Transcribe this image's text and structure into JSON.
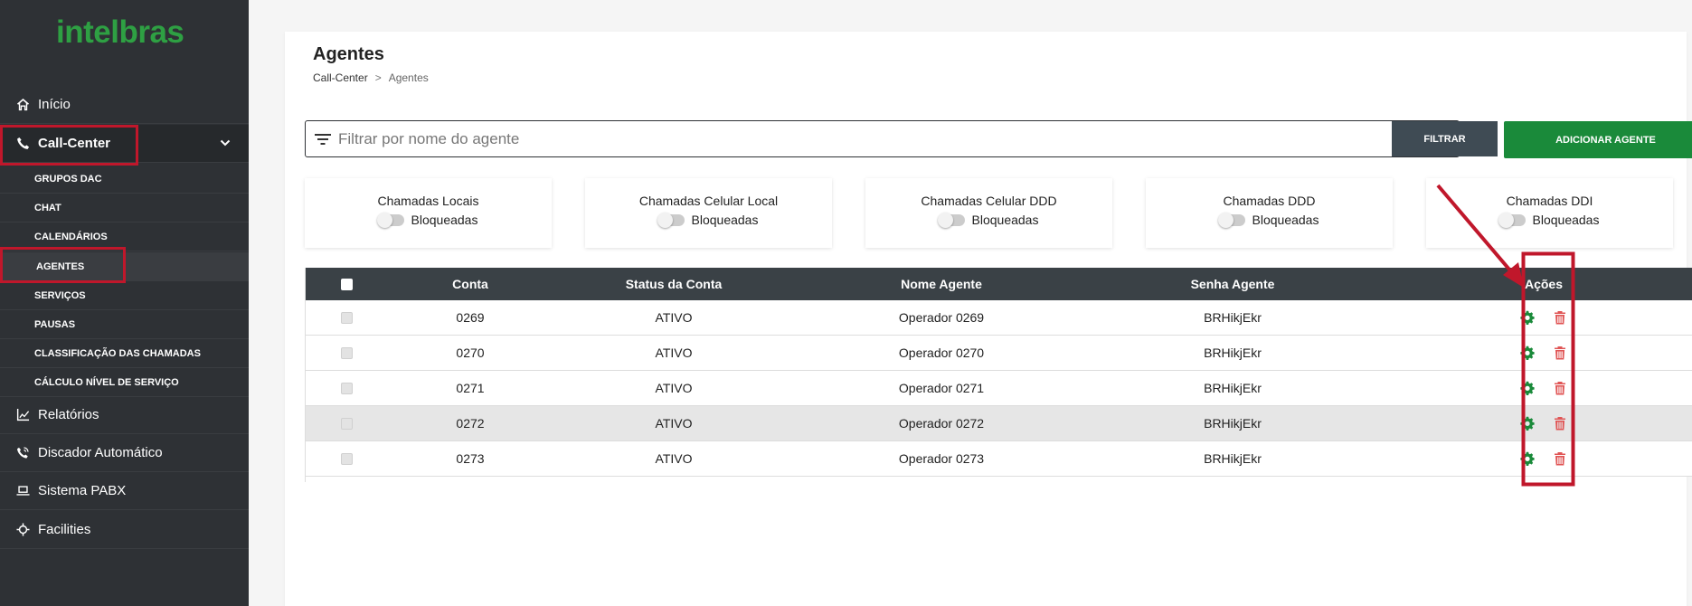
{
  "brand": {
    "logo_text": "intelbras",
    "logo_color": "#2ea043"
  },
  "sidebar": {
    "items": [
      {
        "label": "Início",
        "icon": "home-icon"
      },
      {
        "label": "Call-Center",
        "icon": "phone-icon"
      },
      {
        "label": "Relatórios",
        "icon": "chart-icon"
      },
      {
        "label": "Discador Automático",
        "icon": "phone-volume-icon"
      },
      {
        "label": "Sistema PABX",
        "icon": "laptop-icon"
      },
      {
        "label": "Facilities",
        "icon": "crosshair-icon"
      }
    ],
    "submenu": [
      {
        "label": "GRUPOS DAC"
      },
      {
        "label": "CHAT"
      },
      {
        "label": "CALENDÁRIOS"
      },
      {
        "label": "AGENTES"
      },
      {
        "label": "SERVIÇOS"
      },
      {
        "label": "PAUSAS"
      },
      {
        "label": "CLASSIFICAÇÃO DAS CHAMADAS"
      },
      {
        "label": "CÁLCULO NÍVEL DE SERVIÇO"
      }
    ]
  },
  "page": {
    "title": "Agentes",
    "breadcrumb": {
      "parent": "Call-Center",
      "separator": ">",
      "current": "Agentes"
    }
  },
  "filter": {
    "placeholder": "Filtrar por nome do agente",
    "filter_button": "FILTRAR",
    "add_button": "ADICIONAR AGENTE"
  },
  "cards": [
    {
      "title": "Chamadas Locais",
      "status": "Bloqueadas"
    },
    {
      "title": "Chamadas Celular Local",
      "status": "Bloqueadas"
    },
    {
      "title": "Chamadas Celular DDD",
      "status": "Bloqueadas"
    },
    {
      "title": "Chamadas DDD",
      "status": "Bloqueadas"
    },
    {
      "title": "Chamadas DDI",
      "status": "Bloqueadas"
    }
  ],
  "table": {
    "headers": {
      "conta": "Conta",
      "status": "Status da Conta",
      "nome": "Nome Agente",
      "senha": "Senha Agente",
      "acoes": "Ações"
    },
    "rows": [
      {
        "conta": "0269",
        "status": "ATIVO",
        "nome": "Operador 0269",
        "senha": "BRHikjEkr"
      },
      {
        "conta": "0270",
        "status": "ATIVO",
        "nome": "Operador 0270",
        "senha": "BRHikjEkr"
      },
      {
        "conta": "0271",
        "status": "ATIVO",
        "nome": "Operador 0271",
        "senha": "BRHikjEkr"
      },
      {
        "conta": "0272",
        "status": "ATIVO",
        "nome": "Operador 0272",
        "senha": "BRHikjEkr"
      },
      {
        "conta": "0273",
        "status": "ATIVO",
        "nome": "Operador 0273",
        "senha": "BRHikjEkr"
      }
    ]
  },
  "colors": {
    "sidebar_bg": "#2e3135",
    "accent_green": "#1a8a3a",
    "annotation_red": "#c0172b",
    "delete_red": "#e05555"
  }
}
